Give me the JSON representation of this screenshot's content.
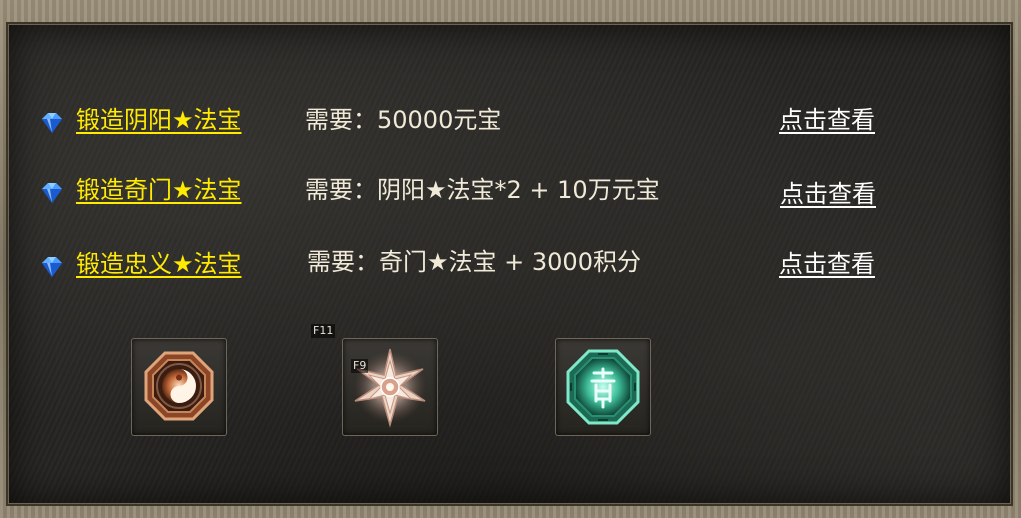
{
  "forge_rows": [
    {
      "title": "锻造阴阳★法宝",
      "requirement": "需要：50000元宝",
      "action": "点击查看"
    },
    {
      "title": "锻造奇门★法宝",
      "requirement": "需要：阴阳★法宝*2 + 10万元宝",
      "action": "点击查看"
    },
    {
      "title": "锻造忠义★法宝",
      "requirement": "需要：奇门★法宝 + 3000积分",
      "action": "点击查看"
    }
  ],
  "item_slots": {
    "hotkey_f11": "F11",
    "hotkey_f9": "F9",
    "items": [
      {
        "icon": "yinyang-bagua-icon"
      },
      {
        "icon": "qimen-star-icon"
      },
      {
        "icon": "zhongyi-dragon-bagua-icon"
      }
    ]
  },
  "colors": {
    "title_link": "#ffea00",
    "requirement_text": "#f1ead8",
    "view_link": "#ffffff",
    "panel_bg": "#262523"
  }
}
